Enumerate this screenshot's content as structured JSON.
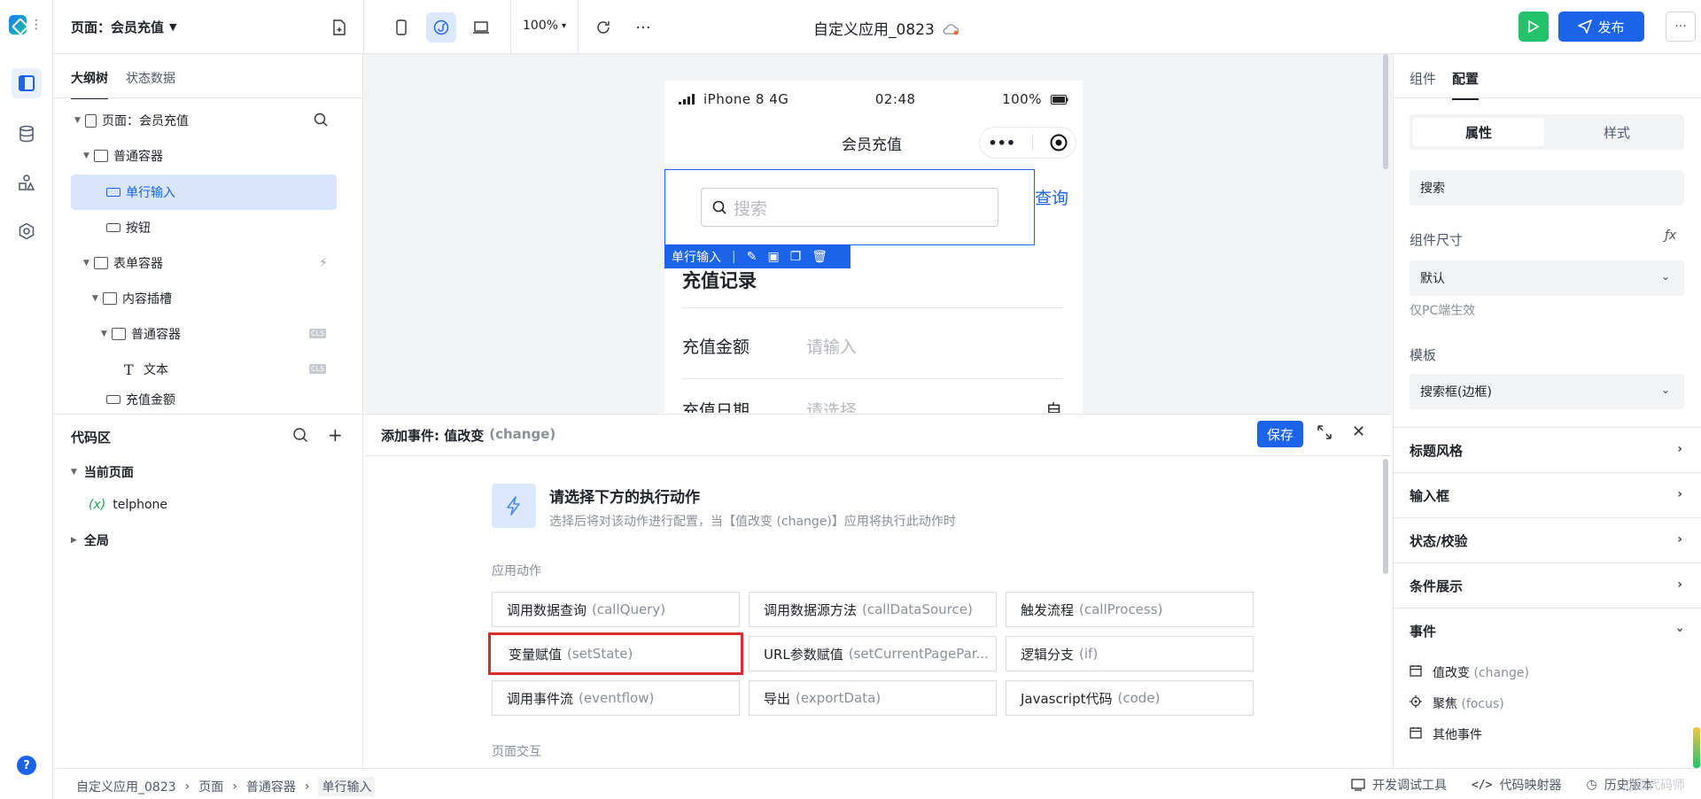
{
  "topbar": {
    "page_selector": "页面：会员充值",
    "zoom": "100%",
    "app_title": "自定义应用_0823",
    "publish_label": "发布"
  },
  "outline": {
    "tabs": [
      "大纲树",
      "状态数据"
    ],
    "nodes": [
      {
        "label": "页面：会员充值"
      },
      {
        "label": "普通容器"
      },
      {
        "label": "单行输入"
      },
      {
        "label": "按钮"
      },
      {
        "label": "表单容器"
      },
      {
        "label": "内容插槽"
      },
      {
        "label": "普通容器"
      },
      {
        "label": "文本"
      },
      {
        "label": "充值金额"
      }
    ],
    "badge": "CLS"
  },
  "code_area": {
    "title": "代码区",
    "current_page": "当前页面",
    "var_prefix": "(x)",
    "var_name": "telphone",
    "global": "全局"
  },
  "phone": {
    "status": {
      "carrier": "iPhone 8  4G",
      "time": "02:48",
      "battery": "100%"
    },
    "nav_title": "会员充值",
    "search_placeholder": "搜索",
    "query_link": "查询",
    "selected_component": "单行输入",
    "record_title": "充值记录",
    "fields": [
      {
        "label": "充值金额",
        "placeholder": "请输入"
      },
      {
        "label": "充值日期",
        "placeholder": "请选择"
      }
    ],
    "partial_char": "自"
  },
  "event_dialog": {
    "title": "添加事件: 值改变",
    "title_sub": "(change)",
    "save_label": "保存",
    "prompt_title": "请选择下方的执行动作",
    "prompt_desc": "选择后将对该动作进行配置，当【值改变 (change)】应用将执行此动作时",
    "section_app": "应用动作",
    "actions": [
      {
        "cn": "调用数据查询",
        "en": "(callQuery)"
      },
      {
        "cn": "调用数据源方法",
        "en": "(callDataSource)"
      },
      {
        "cn": "触发流程",
        "en": "(callProcess)"
      },
      {
        "cn": "变量赋值",
        "en": "(setState)"
      },
      {
        "cn": "URL参数赋值",
        "en": "(setCurrentPagePar..."
      },
      {
        "cn": "逻辑分支",
        "en": "(if)"
      },
      {
        "cn": "调用事件流",
        "en": "(eventflow)"
      },
      {
        "cn": "导出",
        "en": "(exportData)"
      },
      {
        "cn": "Javascript代码",
        "en": "(code)"
      }
    ],
    "section_page": "页面交互"
  },
  "right_panel": {
    "tabs": [
      "组件",
      "配置"
    ],
    "segments": [
      "属性",
      "样式"
    ],
    "name_value": "搜索",
    "size_label": "组件尺寸",
    "fx": "ƒx",
    "size_value": "默认",
    "size_hint": "仅PC端生效",
    "template_label": "模板",
    "template_value": "搜索框(边框)",
    "sections": [
      "标题风格",
      "输入框",
      "状态/校验",
      "条件展示",
      "事件"
    ],
    "events": [
      {
        "cn": "值改变",
        "en": "(change)"
      },
      {
        "cn": "聚焦",
        "en": "(focus)"
      },
      {
        "cn": "其他事件",
        "en": ""
      }
    ]
  },
  "footer": {
    "breadcrumb": [
      "自定义应用_0823",
      "页面",
      "普通容器",
      "单行输入"
    ],
    "dev_tools": "开发调试工具",
    "code_map": "代码映射器",
    "history": "历史版本",
    "watermark": "@低代码师"
  },
  "colors": {
    "accent": "#1b63e8",
    "run": "#22c36a",
    "highlight": "#d62d2d"
  }
}
